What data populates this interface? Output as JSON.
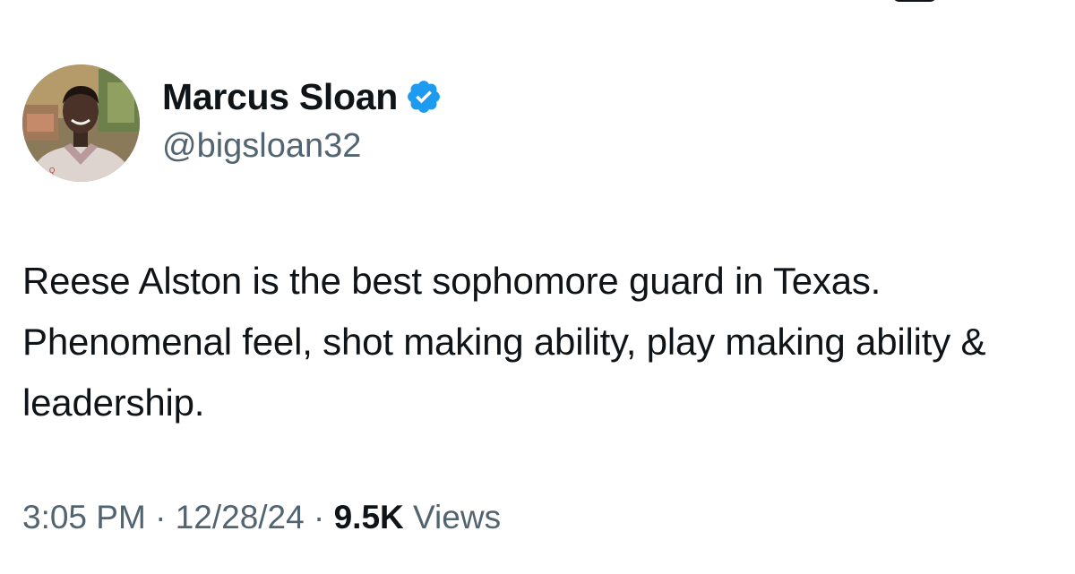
{
  "author": {
    "display_name": "Marcus Sloan",
    "handle": "@bigsloan32",
    "verified": true,
    "verified_color": "#1d9bf0"
  },
  "tweet": {
    "text": "Reese Alston is the best sophomore guard in Texas. Phenomenal feel, shot making ability, play making ability & leadership."
  },
  "meta": {
    "time": "3:05 PM",
    "separator": "·",
    "date": "12/28/24",
    "views_count": "9.5K",
    "views_label": "Views"
  },
  "icons": {
    "verified": "verified-badge-icon",
    "avatar": "profile-photo"
  }
}
